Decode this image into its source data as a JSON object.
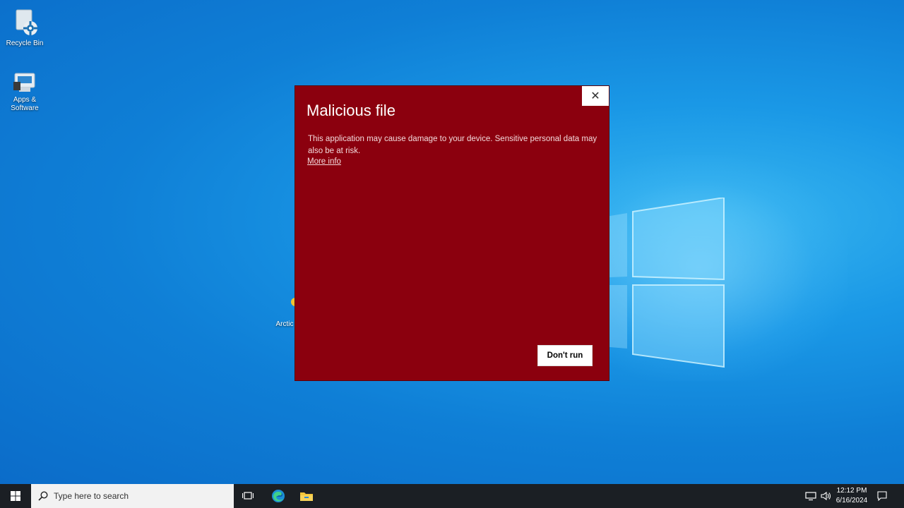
{
  "desktop": {
    "icons": [
      {
        "label": "Recycle Bin"
      },
      {
        "label": "Apps & Software"
      },
      {
        "label": "Arctic"
      }
    ]
  },
  "dialog": {
    "title": "Malicious file",
    "message": "This application may cause damage to your device. Sensitive personal data may also be at risk.",
    "more_info": "More info",
    "dont_run": "Don't run",
    "close": "✕",
    "background": "#8b000e"
  },
  "taskbar": {
    "search_placeholder": "Type here to search",
    "pinned": [
      "task-view-icon",
      "edge-icon",
      "file-explorer-icon"
    ],
    "clock_time": "12:12 PM",
    "clock_date": "6/16/2024"
  }
}
